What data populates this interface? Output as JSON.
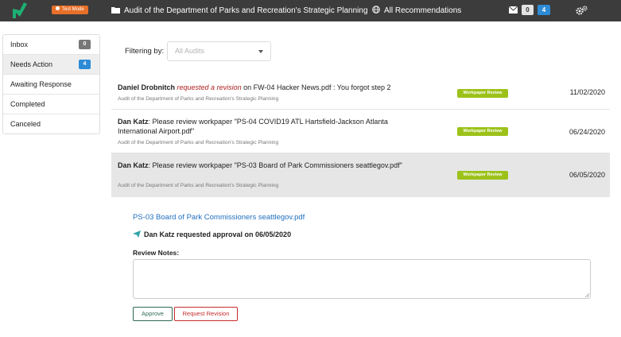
{
  "colors": {
    "topbar": "#3c3c3c",
    "logo": "#1eaf72",
    "test_mode_badge": "#e8702a",
    "count_blue": "#2d8bd6",
    "workpaper_badge": "#9cc21a",
    "revision_text": "#b01f1f",
    "link": "#1f6ebf",
    "approve": "#2f6b57",
    "request_revision": "#c62b2b"
  },
  "topbar": {
    "test_mode_label": "Test Mode",
    "audit_title": "Audit of the Department of Parks and Recreation's Strategic Planning",
    "recommendations_label": "All Recommendations",
    "mail_count": "0",
    "notification_count": "4"
  },
  "sidebar": {
    "items": [
      {
        "label": "Inbox",
        "count": "0"
      },
      {
        "label": "Needs Action",
        "count": "4"
      },
      {
        "label": "Awaiting Response"
      },
      {
        "label": "Completed"
      },
      {
        "label": "Canceled"
      }
    ]
  },
  "filter": {
    "label": "Filtering by:",
    "placeholder": "All Audits"
  },
  "rows": [
    {
      "user": "Daniel Drobnitch",
      "action": "requested a revision",
      "text": " on FW-04 Hacker News.pdf : You forgot step 2",
      "subtitle": "Audit of the Department of Parks and Recreation's Strategic Planning",
      "badge": "Workpaper Review",
      "date": "11/02/2020"
    },
    {
      "user": "Dan Katz",
      "text": ": Please review workpaper \"PS-04 COVID19 ATL Hartsfield-Jackson Atlanta International Airport.pdf\"",
      "subtitle": "Audit of the Department of Parks and Recreation's Strategic Planning",
      "badge": "Workpaper Review",
      "date": "06/24/2020"
    },
    {
      "user": "Dan Katz",
      "text": ": Please review workpaper \"PS-03 Board of Park Commissioners seattlegov.pdf\"",
      "subtitle": "Audit of the Department of Parks and Recreation's Strategic Planning",
      "badge": "Workpaper Review",
      "date": "06/05/2020"
    }
  ],
  "detail": {
    "pdf_link": "PS-03 Board of Park Commissioners seattlegov.pdf",
    "approval_text": "Dan Katz requested approval on 06/05/2020",
    "notes_label": "Review Notes:",
    "approve_label": "Approve",
    "request_revision_label": "Request Revision"
  }
}
